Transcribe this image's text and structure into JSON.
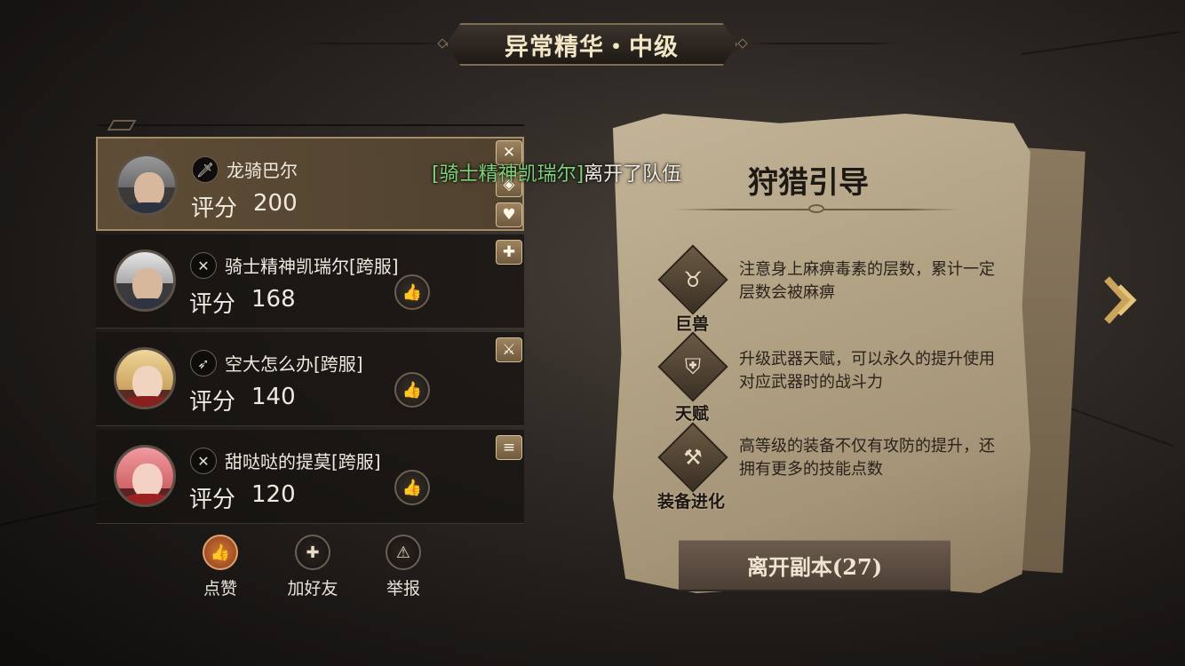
{
  "header": {
    "title": "异常精华・中级"
  },
  "notification": {
    "name": "[骑士精神凯瑞尔]",
    "message": "离开了队伍"
  },
  "players": [
    {
      "name": "龙骑巴尔",
      "score_label": "评分",
      "score": "200",
      "class_icon": "dagger-icon",
      "role_icons": [
        "crossed-swords-icon",
        "shield-icon",
        "heart-icon"
      ],
      "self": true
    },
    {
      "name": "骑士精神凯瑞尔[跨服]",
      "score_label": "评分",
      "score": "168",
      "class_icon": "crossed-swords-icon",
      "role_icons": [
        "plus-icon"
      ]
    },
    {
      "name": "空大怎么办[跨服]",
      "score_label": "评分",
      "score": "140",
      "class_icon": "bow-icon",
      "role_icons": [
        "sword-shield-icon"
      ]
    },
    {
      "name": "甜哒哒的提莫[跨服]",
      "score_label": "评分",
      "score": "120",
      "class_icon": "crossed-swords-icon",
      "role_icons": [
        "speed-icon"
      ]
    }
  ],
  "actions": [
    {
      "label": "点赞",
      "icon": "thumbs-up-icon"
    },
    {
      "label": "加好友",
      "icon": "add-friend-icon"
    },
    {
      "label": "举报",
      "icon": "warning-icon"
    }
  ],
  "guide": {
    "title": "狩猎引导",
    "tips": [
      {
        "label": "巨兽",
        "icon": "beast-icon",
        "text": "注意身上麻痹毒素的层数，累计一定层数会被麻痹"
      },
      {
        "label": "天赋",
        "icon": "helmet-icon",
        "text": "升级武器天赋，可以永久的提升使用对应武器时的战斗力"
      },
      {
        "label": "装备进化",
        "icon": "anvil-icon",
        "text": "高等级的装备不仅有攻防的提升，还拥有更多的技能点数"
      }
    ],
    "leave_button": "离开副本(27)"
  },
  "colors": {
    "notice_name": "#7fd37a",
    "accent_gold": "#d8b56a",
    "like_active": "#d1783e"
  }
}
